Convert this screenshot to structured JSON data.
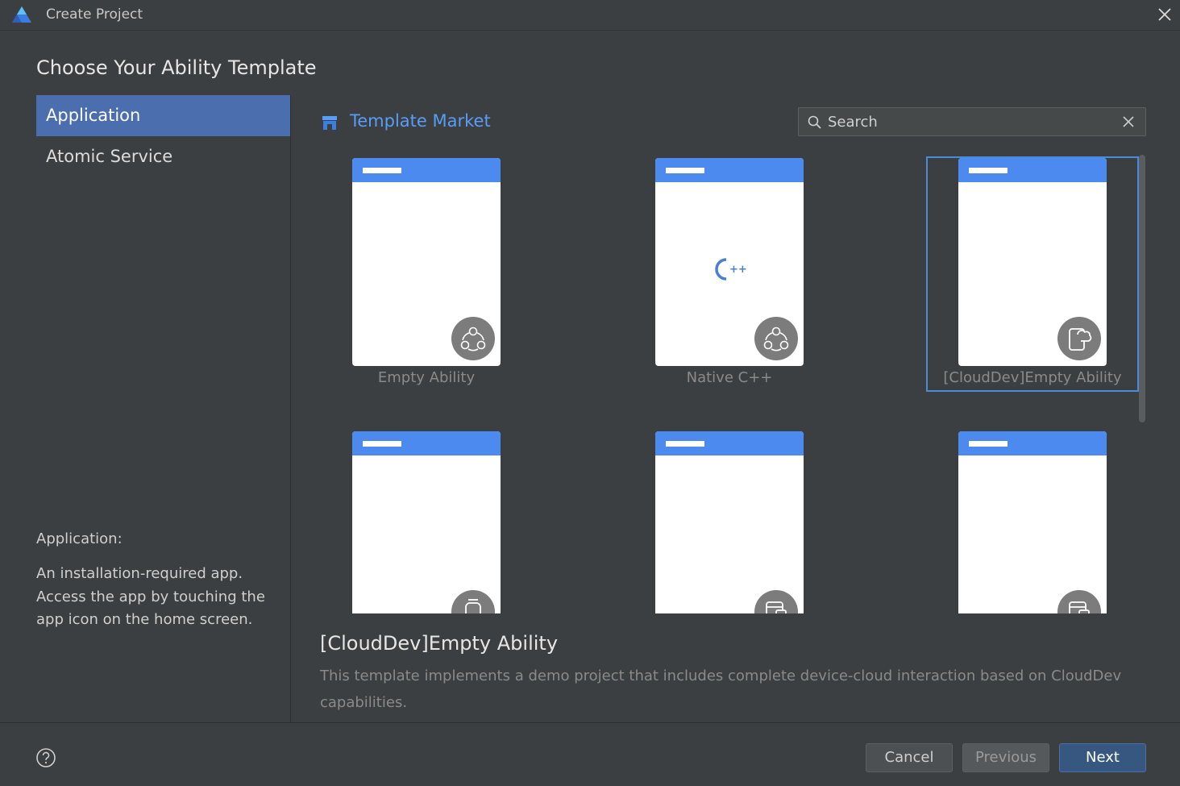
{
  "window": {
    "title": "Create Project",
    "logo_icon": "deveco-logo-icon",
    "close_icon": "close-icon"
  },
  "heading": "Choose Your Ability Template",
  "sidebar": {
    "items": [
      {
        "label": "Application",
        "selected": true
      },
      {
        "label": "Atomic Service",
        "selected": false
      }
    ],
    "description_title": "Application:",
    "description_body": "An installation-required app. Access the app by touching the app icon on the home screen."
  },
  "market": {
    "label": "Template Market",
    "icon": "store-icon"
  },
  "search": {
    "placeholder": "Search",
    "value": ""
  },
  "templates": [
    {
      "label": "Empty Ability",
      "badge": "ability-icon",
      "center_icon": "",
      "selected": false
    },
    {
      "label": "Native C++",
      "badge": "ability-icon",
      "center_icon": "cpp-icon",
      "selected": false
    },
    {
      "label": "[CloudDev]Empty Ability",
      "badge": "cloud-device-icon",
      "center_icon": "",
      "selected": true
    },
    {
      "label": "",
      "badge": "watch-icon",
      "center_icon": "",
      "selected": false
    },
    {
      "label": "",
      "badge": "device-icon",
      "center_icon": "",
      "selected": false
    },
    {
      "label": "",
      "badge": "device-icon",
      "center_icon": "",
      "selected": false
    }
  ],
  "detail": {
    "title": "[CloudDev]Empty Ability",
    "description": "This template implements a demo project that includes complete device-cloud interaction based on CloudDev capabilities."
  },
  "footer": {
    "help_icon": "help-icon",
    "cancel_label": "Cancel",
    "previous_label": "Previous",
    "next_label": "Next"
  },
  "colors": {
    "accent": "#4b6eaf",
    "link": "#589df6",
    "phone_bar": "#4d8af0",
    "next_button": "#365880",
    "background": "#3c3f41"
  }
}
